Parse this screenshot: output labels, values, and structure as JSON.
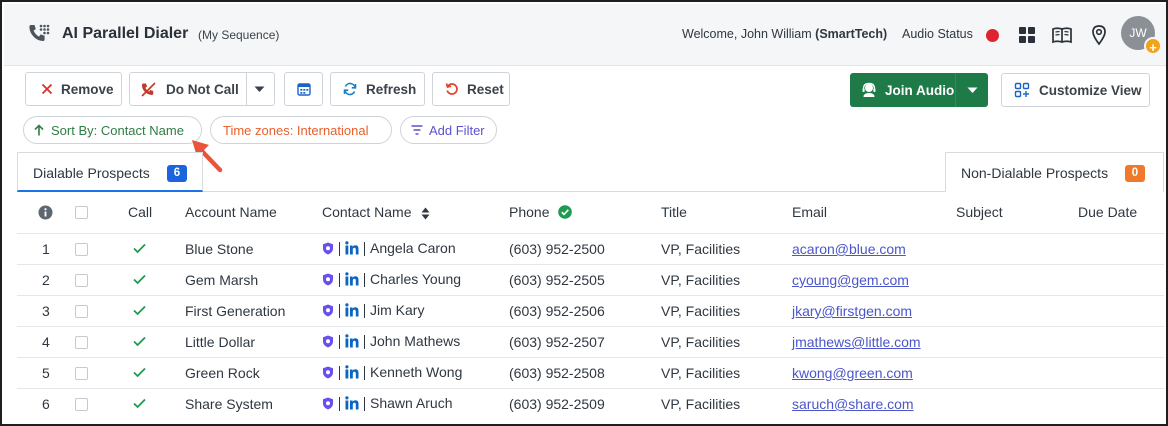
{
  "header": {
    "title": "AI Parallel Dialer",
    "subtitle": "(My Sequence)",
    "welcome_prefix": "Welcome, John William",
    "welcome_org": "(SmartTech)",
    "audio_status_label": "Audio Status",
    "audio_status_color": "#e0232e",
    "avatar_initials": "JW",
    "avatar_badge": "+"
  },
  "toolbar": {
    "remove_label": "Remove",
    "do_not_call_label": "Do Not Call",
    "refresh_label": "Refresh",
    "reset_label": "Reset",
    "join_audio_label": "Join Audio",
    "customize_view_label": "Customize View"
  },
  "chips": {
    "sort_by": "Sort By: Contact Name",
    "time_zones": "Time zones: International",
    "add_filter": "Add Filter"
  },
  "tabs": {
    "dialable_label": "Dialable Prospects",
    "dialable_count": "6",
    "non_dialable_label": "Non-Dialable Prospects",
    "non_dialable_count": "0"
  },
  "table": {
    "headers": {
      "call": "Call",
      "account_name": "Account Name",
      "contact_name": "Contact Name",
      "phone": "Phone",
      "title": "Title",
      "email": "Email",
      "subject": "Subject",
      "due_date": "Due Date"
    },
    "rows": [
      {
        "num": "1",
        "account": "Blue Stone",
        "contact": "Angela Caron",
        "phone": "(603) 952-2500",
        "title": "VP, Facilities",
        "email": "acaron@blue.com"
      },
      {
        "num": "2",
        "account": "Gem Marsh",
        "contact": "Charles Young",
        "phone": "(603) 952-2505",
        "title": "VP, Facilities",
        "email": "cyoung@gem.com"
      },
      {
        "num": "3",
        "account": "First Generation",
        "contact": "Jim Kary",
        "phone": "(603) 952-2506",
        "title": "VP, Facilities",
        "email": "jkary@firstgen.com"
      },
      {
        "num": "4",
        "account": "Little Dollar",
        "contact": "John Mathews",
        "phone": "(603) 952-2507",
        "title": "VP, Facilities",
        "email": "jmathews@little.com"
      },
      {
        "num": "5",
        "account": "Green Rock",
        "contact": "Kenneth Wong",
        "phone": "(603) 952-2508",
        "title": "VP, Facilities",
        "email": "kwong@green.com"
      },
      {
        "num": "6",
        "account": "Share System",
        "contact": "Shawn Aruch",
        "phone": "(603) 952-2509",
        "title": "VP, Facilities",
        "email": "saruch@share.com"
      }
    ]
  },
  "colors": {
    "brand_green": "#1e7a47",
    "sort_green": "#2f7d45",
    "timezone_orange": "#e8602c",
    "filter_purple": "#5a52d1",
    "dialable_badge": "#1a64e0",
    "non_dialable_badge": "#f07a2b",
    "arrow_red": "#e8553a"
  },
  "icons": {
    "app": "phone-dialer-icon",
    "grid": "apps-grid-icon",
    "book": "book-icon",
    "location": "location-pin-icon",
    "remove": "close-icon",
    "do_not_call": "phone-off-icon",
    "calendar": "calendar-icon",
    "refresh": "refresh-icon",
    "reset": "reset-icon",
    "join_audio": "headset-icon",
    "customize": "layout-icon",
    "sort": "arrow-up-icon",
    "filter": "filter-icon",
    "info": "info-icon",
    "call_check": "check-icon",
    "verified": "verified-icon",
    "shield": "shield-icon",
    "linkedin": "linkedin-icon"
  }
}
